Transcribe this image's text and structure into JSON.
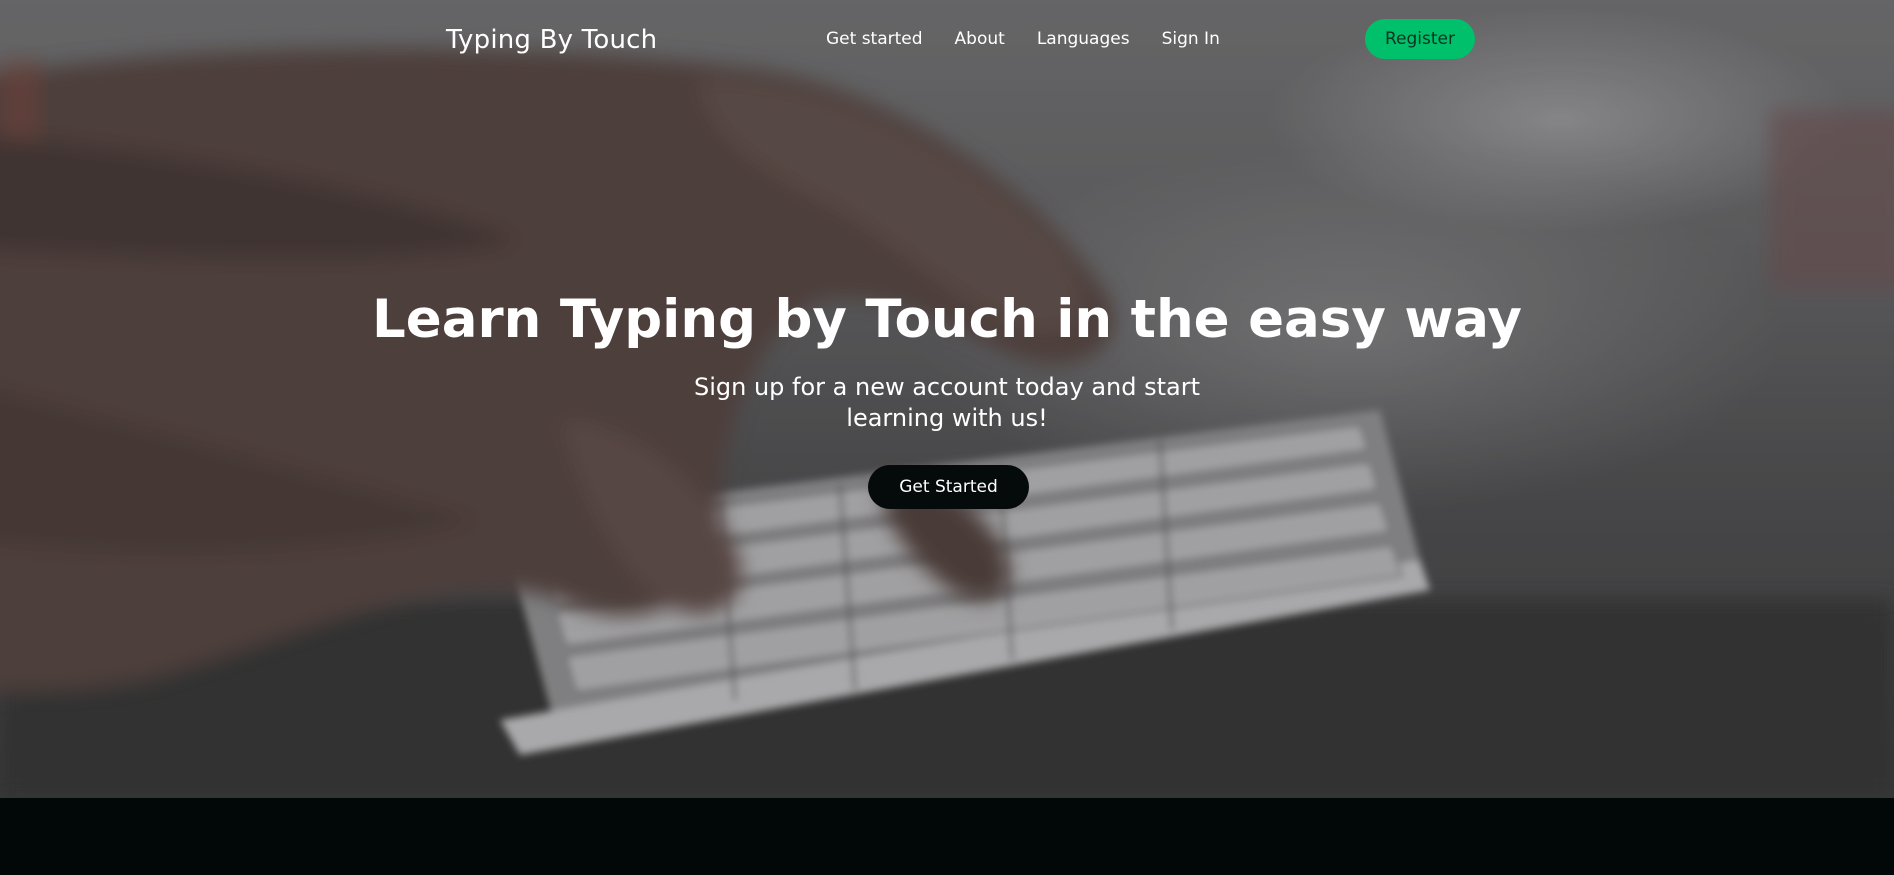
{
  "brand": {
    "name": "Typing By Touch"
  },
  "nav": {
    "items": [
      {
        "label": "Get started"
      },
      {
        "label": "About"
      },
      {
        "label": "Languages"
      },
      {
        "label": "Sign In"
      }
    ],
    "register_label": "Register"
  },
  "hero": {
    "title": "Learn Typing by Touch in the easy way",
    "subtitle": "Sign up for a new account today and start learning with us!",
    "cta_label": "Get Started",
    "background_image": "hands-typing-on-keyboard"
  },
  "colors": {
    "accent": "#00c06b",
    "dark": "#020808",
    "text": "#ffffff"
  }
}
